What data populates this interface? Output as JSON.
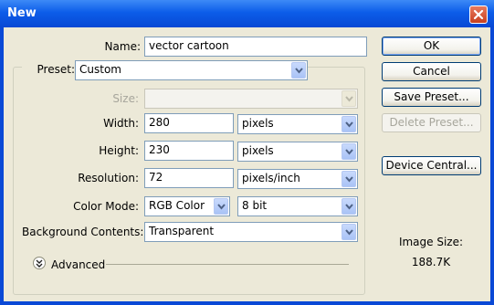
{
  "window": {
    "title": "New"
  },
  "form": {
    "name_label": "Name:",
    "name_value": "vector cartoon",
    "preset_label": "Preset:",
    "preset_value": "Custom",
    "size_label": "Size:",
    "size_value": "",
    "width_label": "Width:",
    "width_value": "280",
    "width_unit": "pixels",
    "height_label": "Height:",
    "height_value": "230",
    "height_unit": "pixels",
    "resolution_label": "Resolution:",
    "resolution_value": "72",
    "resolution_unit": "pixels/inch",
    "color_mode_label": "Color Mode:",
    "color_mode_value": "RGB Color",
    "bit_depth_value": "8 bit",
    "background_label": "Background Contents:",
    "background_value": "Transparent",
    "advanced_label": "Advanced"
  },
  "buttons": {
    "ok": "OK",
    "cancel": "Cancel",
    "save_preset": "Save Preset...",
    "delete_preset": "Delete Preset...",
    "device_central": "Device Central..."
  },
  "image_size": {
    "label": "Image Size:",
    "value": "188.7K"
  },
  "colors": {
    "titlebar": "#0c5de9",
    "client_bg": "#ece9d8",
    "close_button": "#c8401f"
  },
  "icons": [
    "close-icon",
    "chevron-down-icon",
    "advanced-expand-icon"
  ]
}
